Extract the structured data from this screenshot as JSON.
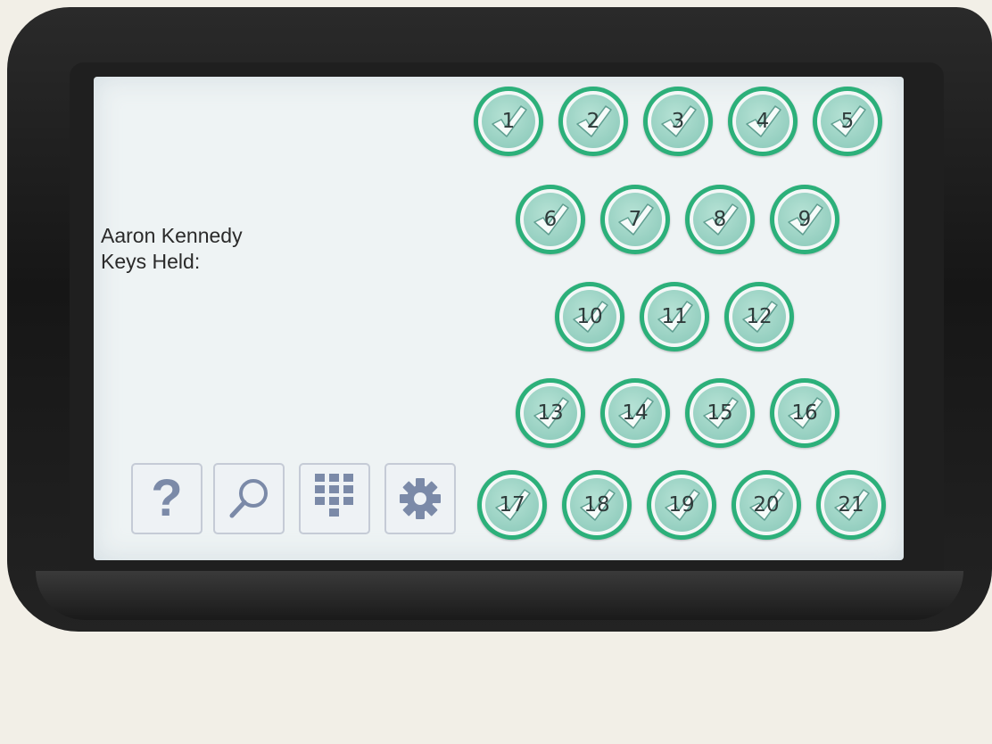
{
  "user": {
    "name": "Aaron Kennedy",
    "keys_held_label": "Keys Held:"
  },
  "keys": [
    {
      "number": "1",
      "checked": true
    },
    {
      "number": "2",
      "checked": true
    },
    {
      "number": "3",
      "checked": true
    },
    {
      "number": "4",
      "checked": true
    },
    {
      "number": "5",
      "checked": true
    },
    {
      "number": "6",
      "checked": true
    },
    {
      "number": "7",
      "checked": true
    },
    {
      "number": "8",
      "checked": true
    },
    {
      "number": "9",
      "checked": true
    },
    {
      "number": "10",
      "checked": true
    },
    {
      "number": "11",
      "checked": true
    },
    {
      "number": "12",
      "checked": true
    },
    {
      "number": "13",
      "checked": true
    },
    {
      "number": "14",
      "checked": true
    },
    {
      "number": "15",
      "checked": true
    },
    {
      "number": "16",
      "checked": true
    },
    {
      "number": "17",
      "checked": true
    },
    {
      "number": "18",
      "checked": true
    },
    {
      "number": "19",
      "checked": true
    },
    {
      "number": "20",
      "checked": true
    },
    {
      "number": "21",
      "checked": true
    }
  ],
  "toolbar": {
    "help_icon": "question-mark-icon",
    "help_glyph": "?",
    "search_icon": "magnifier-icon",
    "keypad_icon": "keypad-icon",
    "settings_icon": "gear-icon"
  },
  "colors": {
    "key_ring": "#2cb07a",
    "key_face": "#95cfc0",
    "tool_icon": "#7b8aa8",
    "screen_bg": "#eef3f4"
  }
}
